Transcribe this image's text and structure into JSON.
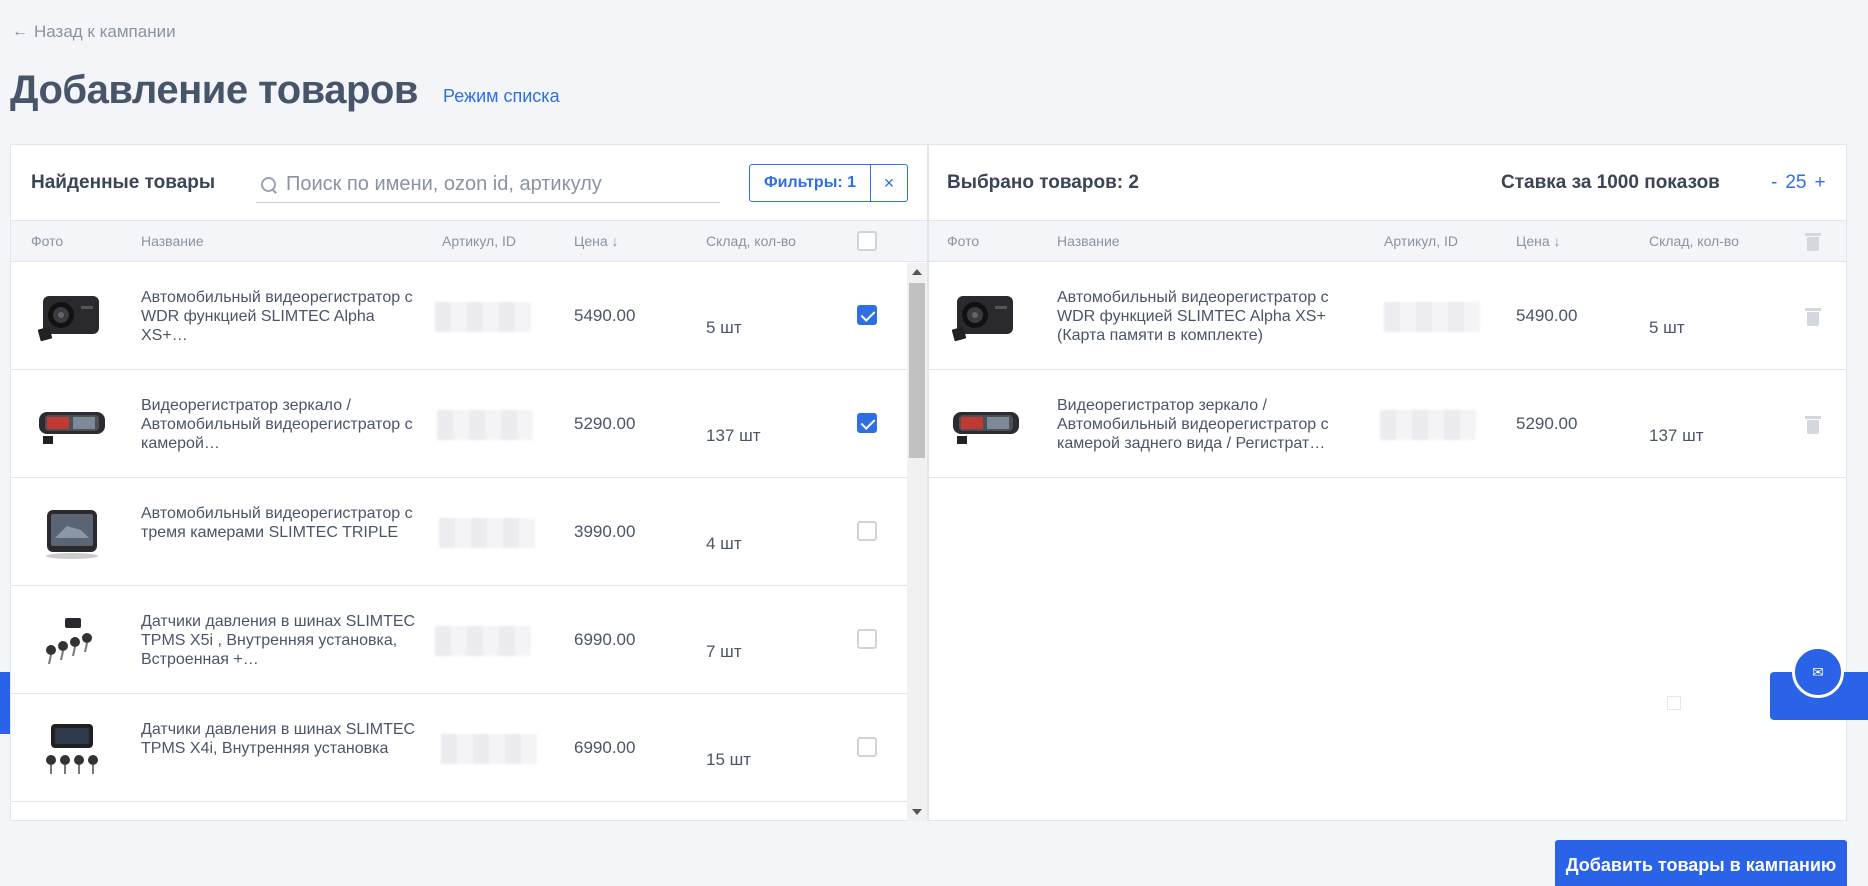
{
  "back_link": "Назад к кампании",
  "page_title": "Добавление товаров",
  "list_mode": "Режим списка",
  "left_panel": {
    "title": "Найденные товары",
    "search_placeholder": "Поиск по имени, ozon id, артикулу",
    "filters_label": "Фильтры: 1",
    "filters_clear": "×",
    "columns": {
      "photo": "Фото",
      "name": "Название",
      "sku": "Артикул, ID",
      "price": "Цена ↓",
      "stock": "Склад, кол-во"
    },
    "rows": [
      {
        "name": "Автомобильный видеорегистратор с WDR функцией SLIMTEC Alpha XS+…",
        "price": "5490.00",
        "stock": "5 шт",
        "checked": true
      },
      {
        "name": "Видеорегистратор зеркало / Автомобильный видеорегистратор с камерой…",
        "price": "5290.00",
        "stock": "137 шт",
        "checked": true
      },
      {
        "name": "Автомобильный видеорегистратор с тремя камерами SLIMTEC TRIPLE",
        "price": "3990.00",
        "stock": "4 шт",
        "checked": false
      },
      {
        "name": "Датчики давления в шинах SLIMTEC TPMS X5i , Внутренняя установка, Встроенная +…",
        "price": "6990.00",
        "stock": "7 шт",
        "checked": false
      },
      {
        "name": "Датчики давления в шинах SLIMTEC TPMS X4i, Внутренняя установка",
        "price": "6990.00",
        "stock": "15 шт",
        "checked": false
      }
    ]
  },
  "right_panel": {
    "title": "Выбрано товаров: 2",
    "bid_label": "Ставка за 1000 показов",
    "bid_minus": "-",
    "bid_value": "25",
    "bid_plus": "+",
    "columns": {
      "photo": "Фото",
      "name": "Название",
      "sku": "Артикул, ID",
      "price": "Цена ↓",
      "stock": "Склад, кол-во"
    },
    "rows": [
      {
        "name": "Автомобильный видеорегистратор с WDR функцией SLIMTEC Alpha XS+ (Карта памяти в комплекте)",
        "price": "5490.00",
        "stock": "5 шт"
      },
      {
        "name": "Видеорегистратор зеркало / Автомобильный видеорегистратор с камерой заднего вида / Регистрат…",
        "price": "5290.00",
        "stock": "137 шт"
      }
    ]
  },
  "add_button": "Добавить товары в кампанию",
  "accent_color": "#2a63e8"
}
